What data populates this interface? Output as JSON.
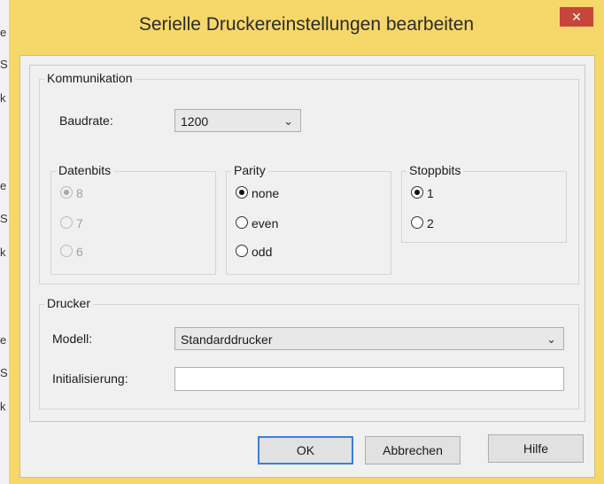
{
  "background_app": {
    "edge_chars": [
      "e",
      "S",
      "k",
      "e",
      "S",
      "k",
      "e",
      "S",
      "k"
    ]
  },
  "dialog": {
    "title": "Serielle Druckereinstellungen bearbeiten",
    "close_glyph": "✕",
    "colors": {
      "frame": "#f6d76a",
      "close": "#c7453b",
      "client": "#f0f0f0",
      "default_border": "#3c7fd4"
    }
  },
  "kommunikation": {
    "label": "Kommunikation",
    "baudrate": {
      "label": "Baudrate:",
      "value": "1200"
    },
    "datenbits": {
      "label": "Datenbits",
      "options": [
        {
          "label": "8",
          "checked": true
        },
        {
          "label": "7",
          "checked": false
        },
        {
          "label": "6",
          "checked": false
        }
      ]
    },
    "parity": {
      "label": "Parity",
      "options": [
        {
          "label": "none",
          "checked": true
        },
        {
          "label": "even",
          "checked": false
        },
        {
          "label": "odd",
          "checked": false
        }
      ]
    },
    "stoppbits": {
      "label": "Stoppbits",
      "options": [
        {
          "label": "1",
          "checked": true
        },
        {
          "label": "2",
          "checked": false
        }
      ]
    }
  },
  "drucker": {
    "label": "Drucker",
    "modell": {
      "label": "Modell:",
      "value": "Standarddrucker"
    },
    "initialisierung": {
      "label": "Initialisierung:",
      "value": ""
    }
  },
  "buttons": {
    "ok": "OK",
    "cancel": "Abbrechen",
    "help": "Hilfe"
  }
}
